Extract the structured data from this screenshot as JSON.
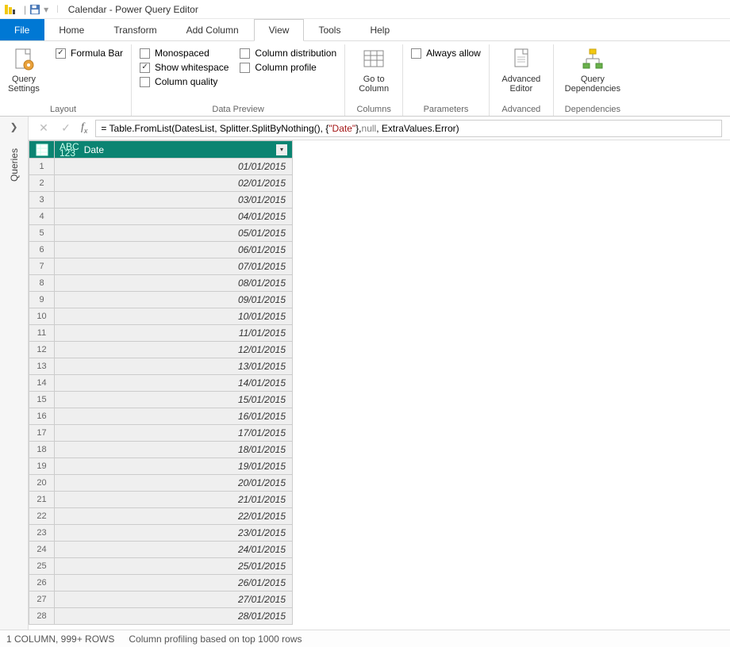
{
  "window": {
    "title": "Calendar - Power Query Editor"
  },
  "quickaccess": {
    "save": "Save"
  },
  "tabs": {
    "file": "File",
    "home": "Home",
    "transform": "Transform",
    "addcolumn": "Add Column",
    "view": "View",
    "tools": "Tools",
    "help": "Help",
    "active": "view"
  },
  "ribbon": {
    "layout": {
      "label": "Layout",
      "query_settings": "Query\nSettings",
      "formula_bar": "Formula Bar"
    },
    "datapreview": {
      "label": "Data Preview",
      "monospaced": "Monospaced",
      "show_whitespace": "Show whitespace",
      "column_quality": "Column quality",
      "column_distribution": "Column distribution",
      "column_profile": "Column profile"
    },
    "columns": {
      "label": "Columns",
      "goto_column": "Go to\nColumn"
    },
    "parameters": {
      "label": "Parameters",
      "always_allow": "Always allow"
    },
    "advanced": {
      "label": "Advanced",
      "advanced_editor": "Advanced\nEditor"
    },
    "dependencies": {
      "label": "Dependencies",
      "query_dependencies": "Query\nDependencies"
    }
  },
  "queries_panel": {
    "label": "Queries"
  },
  "formula": {
    "prefix": "= Table.FromList(DatesList, Splitter.SplitByNothing(), {",
    "string": "\"Date\"",
    "mid1": "}, ",
    "null": "null",
    "mid2": ", ExtraValues.Error)"
  },
  "column_header": "Date",
  "rows": [
    "01/01/2015",
    "02/01/2015",
    "03/01/2015",
    "04/01/2015",
    "05/01/2015",
    "06/01/2015",
    "07/01/2015",
    "08/01/2015",
    "09/01/2015",
    "10/01/2015",
    "11/01/2015",
    "12/01/2015",
    "13/01/2015",
    "14/01/2015",
    "15/01/2015",
    "16/01/2015",
    "17/01/2015",
    "18/01/2015",
    "19/01/2015",
    "20/01/2015",
    "21/01/2015",
    "22/01/2015",
    "23/01/2015",
    "24/01/2015",
    "25/01/2015",
    "26/01/2015",
    "27/01/2015",
    "28/01/2015"
  ],
  "status": {
    "cols_rows": "1 COLUMN, 999+ ROWS",
    "profiling": "Column profiling based on top 1000 rows"
  }
}
